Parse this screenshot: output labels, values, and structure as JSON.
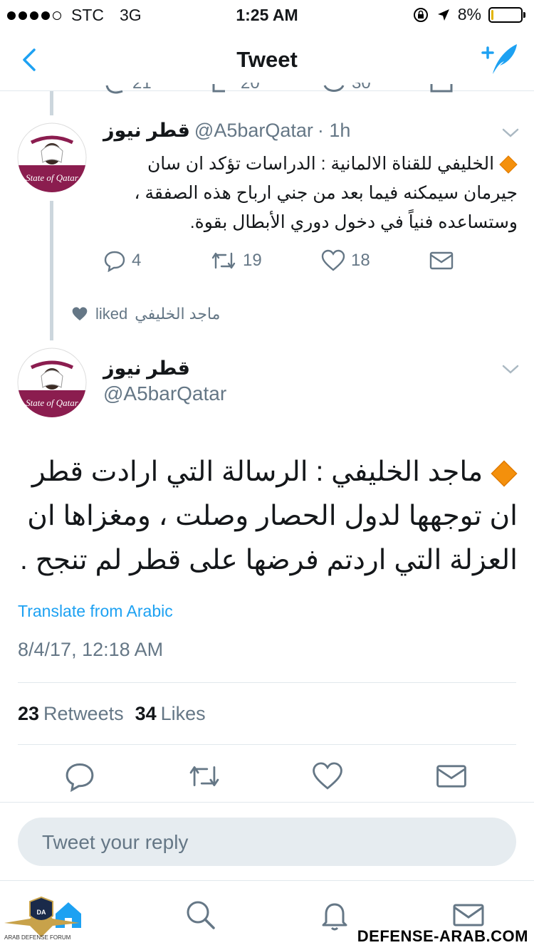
{
  "status": {
    "carrier": "STC",
    "network": "3G",
    "time": "1:25 AM",
    "battery": "8%",
    "battery_level": 0.08
  },
  "nav": {
    "title": "Tweet"
  },
  "tweet1": {
    "name": "قطر نيوز",
    "handle": "@A5barQatar",
    "time": "· 1h",
    "text": "الخليفي للقناة الالمانية : الدراسات تؤكد ان سان جيرمان سيمكنه فيما بعد من جني ارباح هذه الصفقة ، وستساعده فنياً في دخول دوري الأبطال بقوة.",
    "replies": "4",
    "retweets": "19",
    "likes": "18"
  },
  "liked": {
    "name": "ماجد الخليفي",
    "label": "liked"
  },
  "tweet2": {
    "name": "قطر نيوز",
    "handle": "@A5barQatar",
    "text": "ماجد الخليفي : الرسالة التي ارادت قطر ان توجهها لدول الحصار وصلت ، ومغزاها ان العزلة التي اردتم فرضها على قطر لم تنجح .",
    "translate": "Translate from Arabic",
    "timestamp": "8/4/17, 12:18 AM",
    "retweet_count": "23",
    "retweet_label": "Retweets",
    "like_count": "34",
    "like_label": "Likes"
  },
  "reply": {
    "placeholder": "Tweet your reply"
  },
  "watermark": {
    "site": "DEFENSE-ARAB.COM",
    "logo_text": "ARAB DEFENSE FORUM"
  },
  "colors": {
    "accent": "#1da1f2",
    "gray": "#657786",
    "maroon": "#8b1d4f"
  }
}
